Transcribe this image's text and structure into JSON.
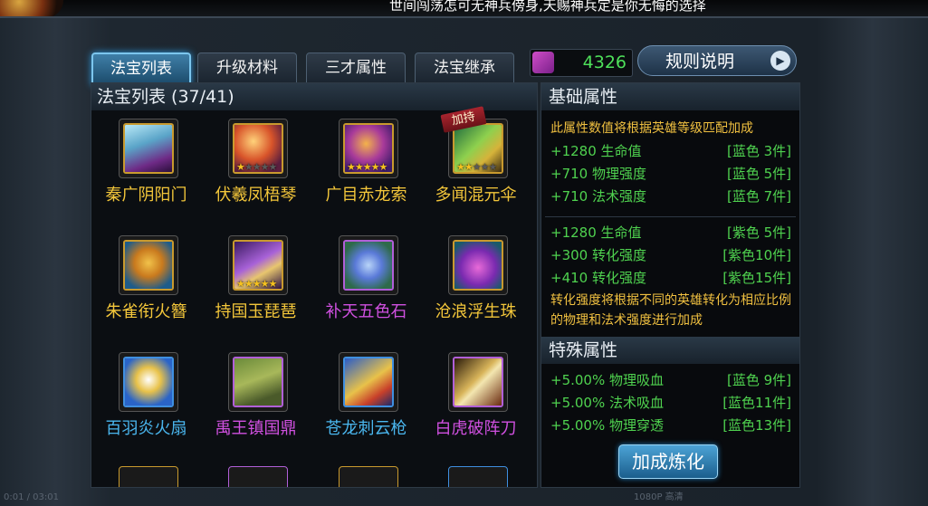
{
  "marquee": "世间闯荡怎可无神兵傍身,天赐神兵定是你无悔的选择",
  "tabs": [
    {
      "label": "法宝列表",
      "active": true
    },
    {
      "label": "升级材料",
      "active": false
    },
    {
      "label": "三才属性",
      "active": false
    },
    {
      "label": "法宝继承",
      "active": false
    }
  ],
  "currency": {
    "value": "4326",
    "icon": "purple-gem-icon"
  },
  "rules_button": "规则说明",
  "list": {
    "title": "法宝列表 (37/41)",
    "items": [
      {
        "name": "秦广阴阳门",
        "stars": 0,
        "frame": "gold",
        "name_color": "#f3c63a"
      },
      {
        "name": "伏羲凤梧琴",
        "stars": 1,
        "frame": "gold",
        "name_color": "#f3c63a"
      },
      {
        "name": "广目赤龙索",
        "stars": 5,
        "frame": "gold",
        "name_color": "#f3c63a"
      },
      {
        "name": "多闻混元伞",
        "stars": 2,
        "frame": "gold",
        "name_color": "#f3c63a",
        "badge": "加持"
      },
      {
        "name": "朱雀衔火簪",
        "stars": 0,
        "frame": "gold",
        "name_color": "#f3c63a"
      },
      {
        "name": "持国玉琵琶",
        "stars": 5,
        "frame": "gold",
        "name_color": "#f3c63a"
      },
      {
        "name": "补天五色石",
        "stars": 0,
        "frame": "purple",
        "name_color": "#d050e0"
      },
      {
        "name": "沧浪浮生珠",
        "stars": 0,
        "frame": "gold",
        "name_color": "#f3c63a"
      },
      {
        "name": "百羽炎火扇",
        "stars": 0,
        "frame": "blue",
        "name_color": "#4ab6ee"
      },
      {
        "name": "禹王镇国鼎",
        "stars": 0,
        "frame": "purple",
        "name_color": "#d050e0"
      },
      {
        "name": "苍龙刺云枪",
        "stars": 0,
        "frame": "blue",
        "name_color": "#4ab6ee"
      },
      {
        "name": "白虎破阵刀",
        "stars": 0,
        "frame": "purple",
        "name_color": "#d050e0"
      }
    ]
  },
  "basic": {
    "title": "基础属性",
    "note": "此属性数值将根据英雄等级匹配加成",
    "group1": [
      {
        "stat": "+1280 生命值",
        "req": "[蓝色 3件]"
      },
      {
        "stat": "+710 物理强度",
        "req": "[蓝色 5件]"
      },
      {
        "stat": "+710 法术强度",
        "req": "[蓝色 7件]"
      }
    ],
    "group2": [
      {
        "stat": "+1280 生命值",
        "req": "[紫色 5件]"
      },
      {
        "stat": "+300 转化强度",
        "req": "[紫色10件]"
      },
      {
        "stat": "+410 转化强度",
        "req": "[紫色15件]"
      }
    ],
    "conversion_note": "转化强度将根据不同的英雄转化为相应比例的物理和法术强度进行加成"
  },
  "special": {
    "title": "特殊属性",
    "rows": [
      {
        "stat": "+5.00% 物理吸血",
        "req": "[蓝色 9件]"
      },
      {
        "stat": "+5.00% 法术吸血",
        "req": "[蓝色11件]"
      },
      {
        "stat": "+5.00% 物理穿透",
        "req": "[蓝色13件]"
      }
    ]
  },
  "refine_button": "加成炼化",
  "overlay": {
    "time": "0:01 / 03:01",
    "quality": "1080P 高清"
  },
  "colors": {
    "accent": "#7cc6ee",
    "stat_green": "#4fd24f",
    "note_gold": "#f0c040",
    "currency_green": "#4ee05a"
  }
}
